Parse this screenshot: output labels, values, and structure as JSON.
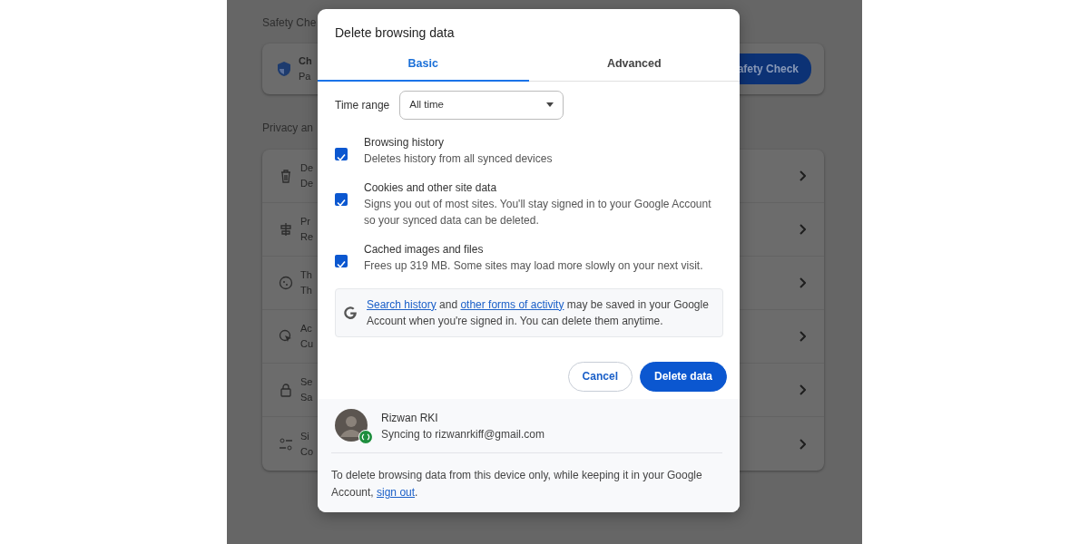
{
  "background": {
    "safety": {
      "title": "Safety Che",
      "card_title": "Ch",
      "card_subtitle": "Pa",
      "button": "afety Check"
    },
    "privacy": {
      "title": "Privacy an",
      "rows": [
        {
          "title": "De",
          "subtitle": "De"
        },
        {
          "title": "Pr",
          "subtitle": "Re"
        },
        {
          "title": "Th",
          "subtitle": "Th"
        },
        {
          "title": "Ac",
          "subtitle": "Cu"
        },
        {
          "title": "Se",
          "subtitle": "Sa"
        },
        {
          "title": "Si",
          "subtitle": "Co"
        }
      ]
    }
  },
  "dialog": {
    "title": "Delete browsing data",
    "tabs": [
      {
        "label": "Basic",
        "selected": true
      },
      {
        "label": "Advanced",
        "selected": false
      }
    ],
    "time_range": {
      "label": "Time range",
      "value": "All time"
    },
    "options": [
      {
        "title": "Browsing history",
        "description": "Deletes history from all synced devices",
        "checked": true
      },
      {
        "title": "Cookies and other site data",
        "description": "Signs you out of most sites. You'll stay signed in to your Google Account so your synced data can be deleted.",
        "checked": true
      },
      {
        "title": "Cached images and files",
        "description": "Frees up 319 MB. Some sites may load more slowly on your next visit.",
        "checked": true
      }
    ],
    "info": [
      {
        "text": "Search history",
        "kind": "link"
      },
      {
        "text": " and ",
        "kind": "text"
      },
      {
        "text": "other forms of activity",
        "kind": "link"
      },
      {
        "text": " may be saved in your Google Account when you're signed in. You can delete them anytime.",
        "kind": "text"
      }
    ],
    "buttons": [
      {
        "label": "Cancel",
        "kind": "secondary"
      },
      {
        "label": "Delete data",
        "kind": "primary"
      }
    ],
    "account": {
      "name": "Rizwan RKI",
      "status": "Syncing to rizwanrkiff@gmail.com"
    },
    "note": [
      {
        "text": "To delete browsing data from this device only, while keeping it in your Google Account, ",
        "kind": "text"
      },
      {
        "text": "sign out",
        "kind": "link"
      },
      {
        "text": ".",
        "kind": "text"
      }
    ]
  }
}
